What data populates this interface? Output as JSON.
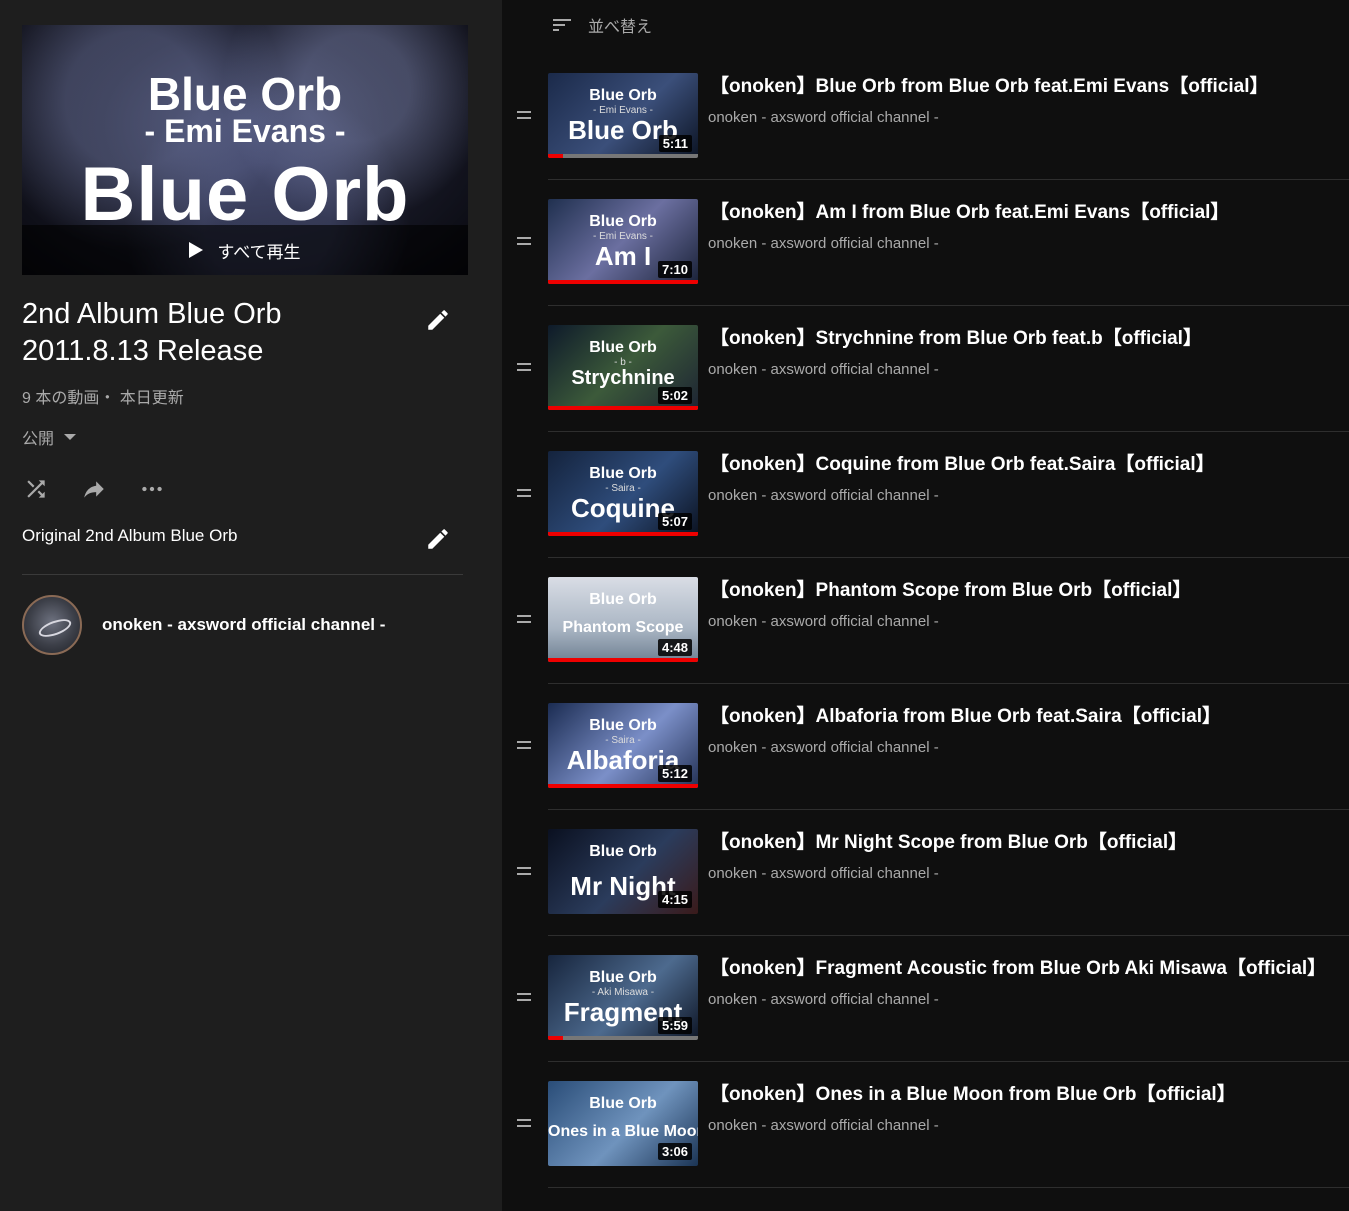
{
  "colors": {
    "background": "#0f0f0f",
    "sidebar": "#1e1e1e",
    "progress": "#ee0000",
    "secondary_text": "#aaaaaa"
  },
  "playlist": {
    "hero": {
      "line1": "Blue Orb",
      "line2": "- Emi Evans -",
      "line3": "Blue Orb",
      "play_all_label": "すべて再生"
    },
    "title": "2nd Album Blue Orb 2011.8.13 Release",
    "meta": "9 本の動画・ 本日更新",
    "privacy": "公開",
    "description": "Original 2nd Album Blue Orb",
    "owner": "onoken - axsword official channel -"
  },
  "icons": {
    "edit": "pencil-icon",
    "shuffle": "shuffle-icon",
    "share": "share-icon",
    "more": "more-icon",
    "sort": "sort-icon",
    "drag": "drag-handle-icon",
    "play": "play-icon"
  },
  "sort_label": "並べ替え",
  "videos": [
    {
      "title": "【onoken】Blue Orb from Blue Orb feat.Emi Evans【official】",
      "channel": "onoken - axsword official channel -",
      "duration": "5:11",
      "progress": 0.1,
      "thumb_line1": "Blue Orb",
      "thumb_line2": "- Emi Evans -",
      "thumb_line3": "Blue Orb"
    },
    {
      "title": "【onoken】Am I from Blue Orb feat.Emi Evans【official】",
      "channel": "onoken - axsword official channel -",
      "duration": "7:10",
      "progress": 1.0,
      "thumb_line1": "Blue Orb",
      "thumb_line2": "- Emi Evans -",
      "thumb_line3": "Am I"
    },
    {
      "title": "【onoken】Strychnine from Blue Orb feat.b【official】",
      "channel": "onoken - axsword official channel -",
      "duration": "5:02",
      "progress": 1.0,
      "thumb_line1": "Blue Orb",
      "thumb_line2": "- b -",
      "thumb_line3": "Strychnine"
    },
    {
      "title": "【onoken】Coquine from Blue Orb feat.Saira【official】",
      "channel": "onoken - axsword official channel -",
      "duration": "5:07",
      "progress": 1.0,
      "thumb_line1": "Blue Orb",
      "thumb_line2": "- Saira -",
      "thumb_line3": "Coquine"
    },
    {
      "title": "【onoken】Phantom Scope from Blue Orb【official】",
      "channel": "onoken - axsword official channel -",
      "duration": "4:48",
      "progress": 1.0,
      "thumb_line1": "Blue Orb",
      "thumb_line2": "",
      "thumb_line3": "Phantom Scope"
    },
    {
      "title": "【onoken】Albaforia from Blue Orb feat.Saira【official】",
      "channel": "onoken - axsword official channel -",
      "duration": "5:12",
      "progress": 1.0,
      "thumb_line1": "Blue Orb",
      "thumb_line2": "- Saira -",
      "thumb_line3": "Albaforia"
    },
    {
      "title": "【onoken】Mr Night Scope from Blue Orb【official】",
      "channel": "onoken - axsword official channel -",
      "duration": "4:15",
      "progress": 0.0,
      "thumb_line1": "Blue Orb",
      "thumb_line2": "",
      "thumb_line3": "Mr Night"
    },
    {
      "title": "【onoken】Fragment Acoustic from Blue Orb Aki Misawa【official】",
      "channel": "onoken - axsword official channel -",
      "duration": "5:59",
      "progress": 0.1,
      "thumb_line1": "Blue Orb",
      "thumb_line2": "- Aki Misawa -",
      "thumb_line3": "Fragment"
    },
    {
      "title": "【onoken】Ones in a Blue Moon from Blue Orb【official】",
      "channel": "onoken - axsword official channel -",
      "duration": "3:06",
      "progress": 0.0,
      "thumb_line1": "Blue Orb",
      "thumb_line2": "",
      "thumb_line3": "Ones in a Blue Moon"
    }
  ]
}
